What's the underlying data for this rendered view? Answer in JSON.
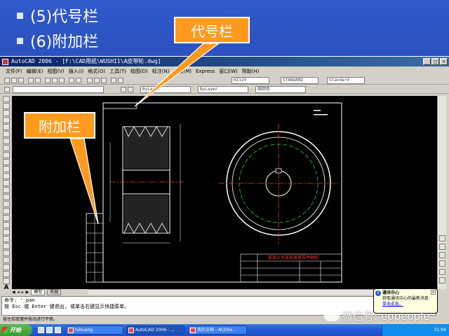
{
  "slide": {
    "bullets": [
      "(5)代号栏",
      "(6)附加栏"
    ]
  },
  "callouts": {
    "code_column": "代号栏",
    "extra_column": "附加栏"
  },
  "acad": {
    "title": "AutoCAD 2006 - [F:\\CAD用纸\\WUSHI1\\A皮带轮.dwg]",
    "window_buttons": [
      "_",
      "□",
      "×"
    ],
    "menu": [
      "文件(F)",
      "编辑(E)",
      "视图(V)",
      "插入(I)",
      "格式(O)",
      "工具(T)",
      "绘图(D)",
      "标注(N)",
      "修改(M)",
      "Express",
      "窗口(W)",
      "帮助(H)"
    ],
    "style_selects": [
      "HZ129",
      "STANDARD",
      "Standard"
    ],
    "layer_selects": [
      "ByLayer",
      "ByLayer",
      "随颜色"
    ],
    "tabs": [
      "模型",
      "布局"
    ],
    "command_lines": [
      "命令: '_pan",
      "按 Esc 或 Enter 键退出, 或单击右键显示快捷菜单。"
    ],
    "status": "按住拾取键并拖动进行平移。"
  },
  "drawing": {
    "title_block_note": "某某公司某某某某零件图纸"
  },
  "balloon": {
    "title": "通讯中心",
    "text": "获取通讯中心的最新消息",
    "link": "单击此处。",
    "close": "×",
    "info": "i"
  },
  "taskbar": {
    "start": "开始",
    "items": [
      "tubuang",
      "AutoCAD 2006 - ...",
      "我的文档 - ACDSe..."
    ],
    "clock": "21:04"
  },
  "watermark": "微信号: eppeople",
  "colors": {
    "slide_bg": "#2546b4",
    "callout_orange": "#ff9a1f",
    "canvas_bg": "#000000"
  }
}
